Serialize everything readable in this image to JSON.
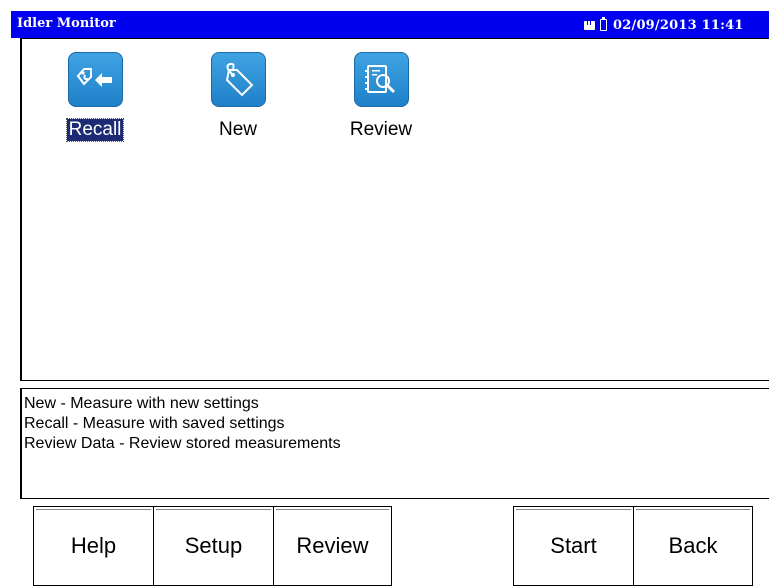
{
  "titlebar": {
    "app_title": "Idler Monitor",
    "datetime": "02/09/2013 11:41"
  },
  "apps": [
    {
      "label": "Recall",
      "icon": "recall-icon",
      "selected": true
    },
    {
      "label": "New",
      "icon": "new-tag-icon",
      "selected": false
    },
    {
      "label": "Review",
      "icon": "review-icon",
      "selected": false
    }
  ],
  "description": {
    "lines": [
      "New - Measure with new settings",
      "Recall - Measure with saved settings",
      "Review Data - Review stored measurements"
    ]
  },
  "softkeys": {
    "help": "Help",
    "setup": "Setup",
    "review": "Review",
    "start": "Start",
    "back": "Back"
  },
  "colors": {
    "title_bar": "#0000ee",
    "icon_blue": "#2d8fd8",
    "selection": "#1c2b74"
  }
}
